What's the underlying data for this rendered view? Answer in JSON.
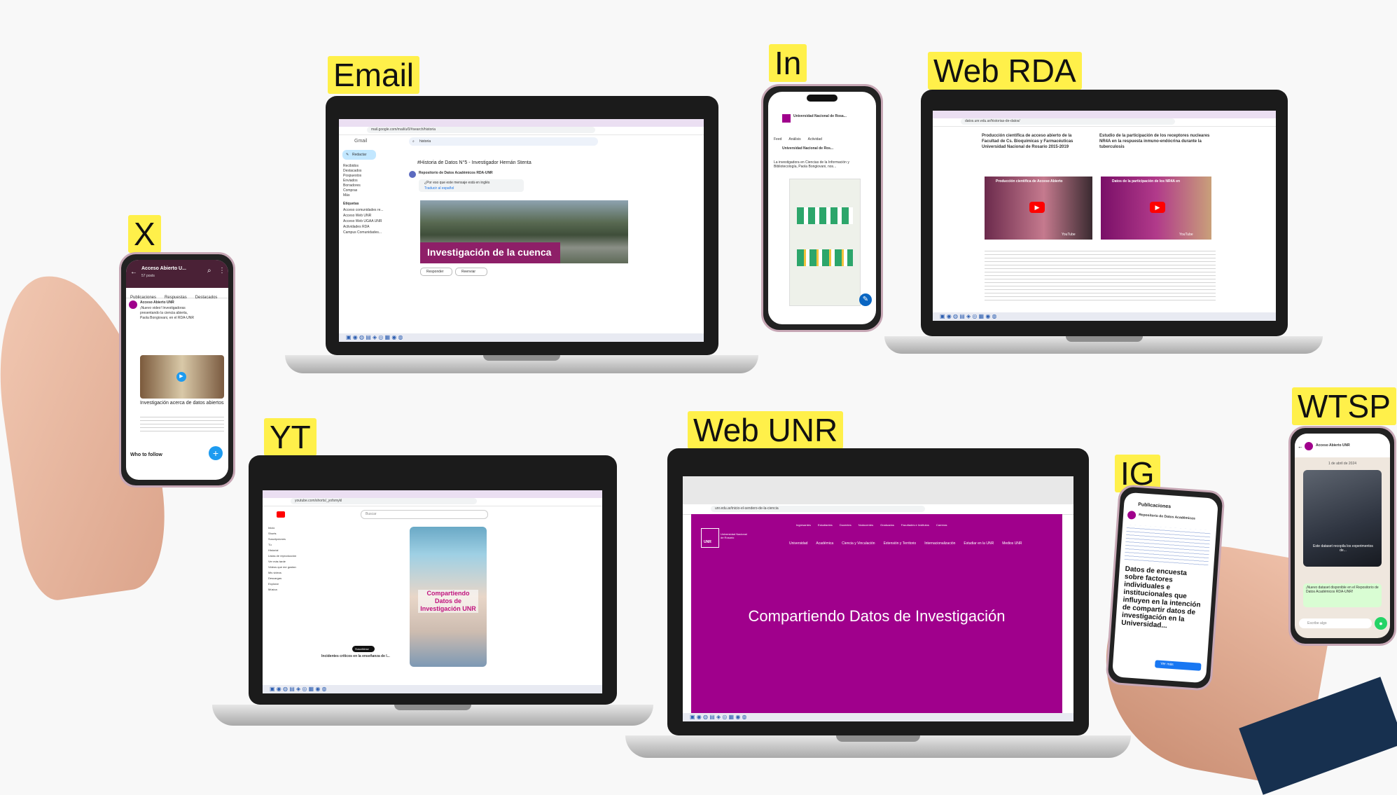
{
  "labels": {
    "x": "X",
    "email": "Email",
    "in": "In",
    "web_rda": "Web RDA",
    "yt": "YT",
    "web_unr": "Web UNR",
    "ig": "IG",
    "wtsp": "WTSP"
  },
  "colors": {
    "label_bg": "#fff04a",
    "unr_magenta": "#a0008c",
    "laptop_frame": "#1b1b1b"
  },
  "x_phone": {
    "title": "Acceso Abierto U...",
    "count": "57 posts",
    "tabs": [
      "Publicaciones",
      "Respuestas",
      "Destacados"
    ],
    "author": "Acceso Abierto UNR",
    "post_line1": "¡Nuevo video! Investigadoras",
    "post_line2": "presentando la ciencia abierta,",
    "post_line3": "Paola Bongiovani, en el RDA-UNR",
    "card_title": "Investigación acerca de datos abiertos",
    "who_to_follow": "Who to follow"
  },
  "email_laptop": {
    "url": "mail.google.com/mail/u/0/#search/historia",
    "app": "Gmail",
    "search": "historia",
    "compose": "Redactar",
    "nav": [
      "Recibidos",
      "Destacados",
      "Pospuestos",
      "Enviados",
      "Borradores",
      "Compras",
      "Más"
    ],
    "labels_header": "Etiquetas",
    "label_items": [
      "Acceso comunidades re...",
      "Acceso Web UNR",
      "Acceso Web UGAA UNR",
      "Actividades RDA",
      "Campus Comunidades..."
    ],
    "subject": "#Historia de Datos N°5 - Investigador Hernán Stenta",
    "sender": "Repositorio de Datos Académicos RDA-UNR",
    "translate_prompt": "¿Por eso que este mensaje está en inglés",
    "translate_link": "Traducir al español",
    "banner": "Investigación de la cuenca",
    "reply": "Responder",
    "forward": "Reenviar"
  },
  "in_phone": {
    "org": "Universidad Nacional de Rosa...",
    "tabs": [
      "Feed",
      "Análisis",
      "Actividad"
    ],
    "post_org": "Universidad Nacional de Ros...",
    "post_text": "La investigadora en Ciencias de la Información y Bibliotecología, Paola Bongiovani, nos..."
  },
  "rda_laptop": {
    "url": "datos.unr.edu.ar/historias-de-datos/",
    "col1_title": "Producción científica de acceso abierto de la Facultad de Cs. Bioquímicas y Farmacéuticas Universidad Nacional de Rosario 2015-2019",
    "col2_title": "Estudio de la participación de los receptores nucleares NR4A en la respuesta inmuno-endócrina durante la tuberculosis",
    "video1": "Producción científica de Acceso Abierto",
    "video2": "Datos de la participación de los NR4A en",
    "youtube": "YouTube"
  },
  "yt_laptop": {
    "url": "youtube.com/shorts/_yofsmykl",
    "search": "Buscar",
    "nav": [
      "Inicio",
      "Shorts",
      "Suscripciones",
      "Tú",
      "Historial",
      "Listas de reproducción",
      "Ver más tarde",
      "Videos que me gustan",
      "Mis videos",
      "Descargas",
      "Explorar",
      "Música"
    ],
    "short_title": "Compartiendo Datos de Investigación UNR",
    "short_caption": "Incidentes críticos en la enseñanza de l...",
    "subscribe": "Suscribirse"
  },
  "unr_laptop": {
    "url": "unr.edu.ar/inicio-el-sendero-de-la-ciencia",
    "top_links": [
      "Ingresantes",
      "Estudiantes",
      "Docentes",
      "Nodocentes",
      "Graduados",
      "Facultades e Institutos",
      "Carreras"
    ],
    "nav_links": [
      "Universidad",
      "Académica",
      "Ciencia y Vinculación",
      "Extensión y Territorio",
      "Internacionalización",
      "Estudiar en la UNR",
      "Medios UNR"
    ],
    "logo": "UNR",
    "logo_caption": "Universidad Nacional de Rosario",
    "hero": "Compartiendo Datos de Investigación"
  },
  "ig_phone": {
    "header": "Publicaciones",
    "account": "Repositorio de Datos Académicos",
    "post_title": "Datos de encuesta sobre factores individuales e institucionales que influyen en la intención de compartir datos de investigación en la Universidad...",
    "cta": "Ver más"
  },
  "wtsp_phone": {
    "chat": "Acceso Abierto UNR",
    "date": "1 de abril de 2024",
    "overlay": "Este dataset recopila los experimentos de...",
    "message": "¡Nuevo dataset disponible en el Repositorio de Datos Académicos RDA-UNR!",
    "input": "Escribe algo"
  }
}
